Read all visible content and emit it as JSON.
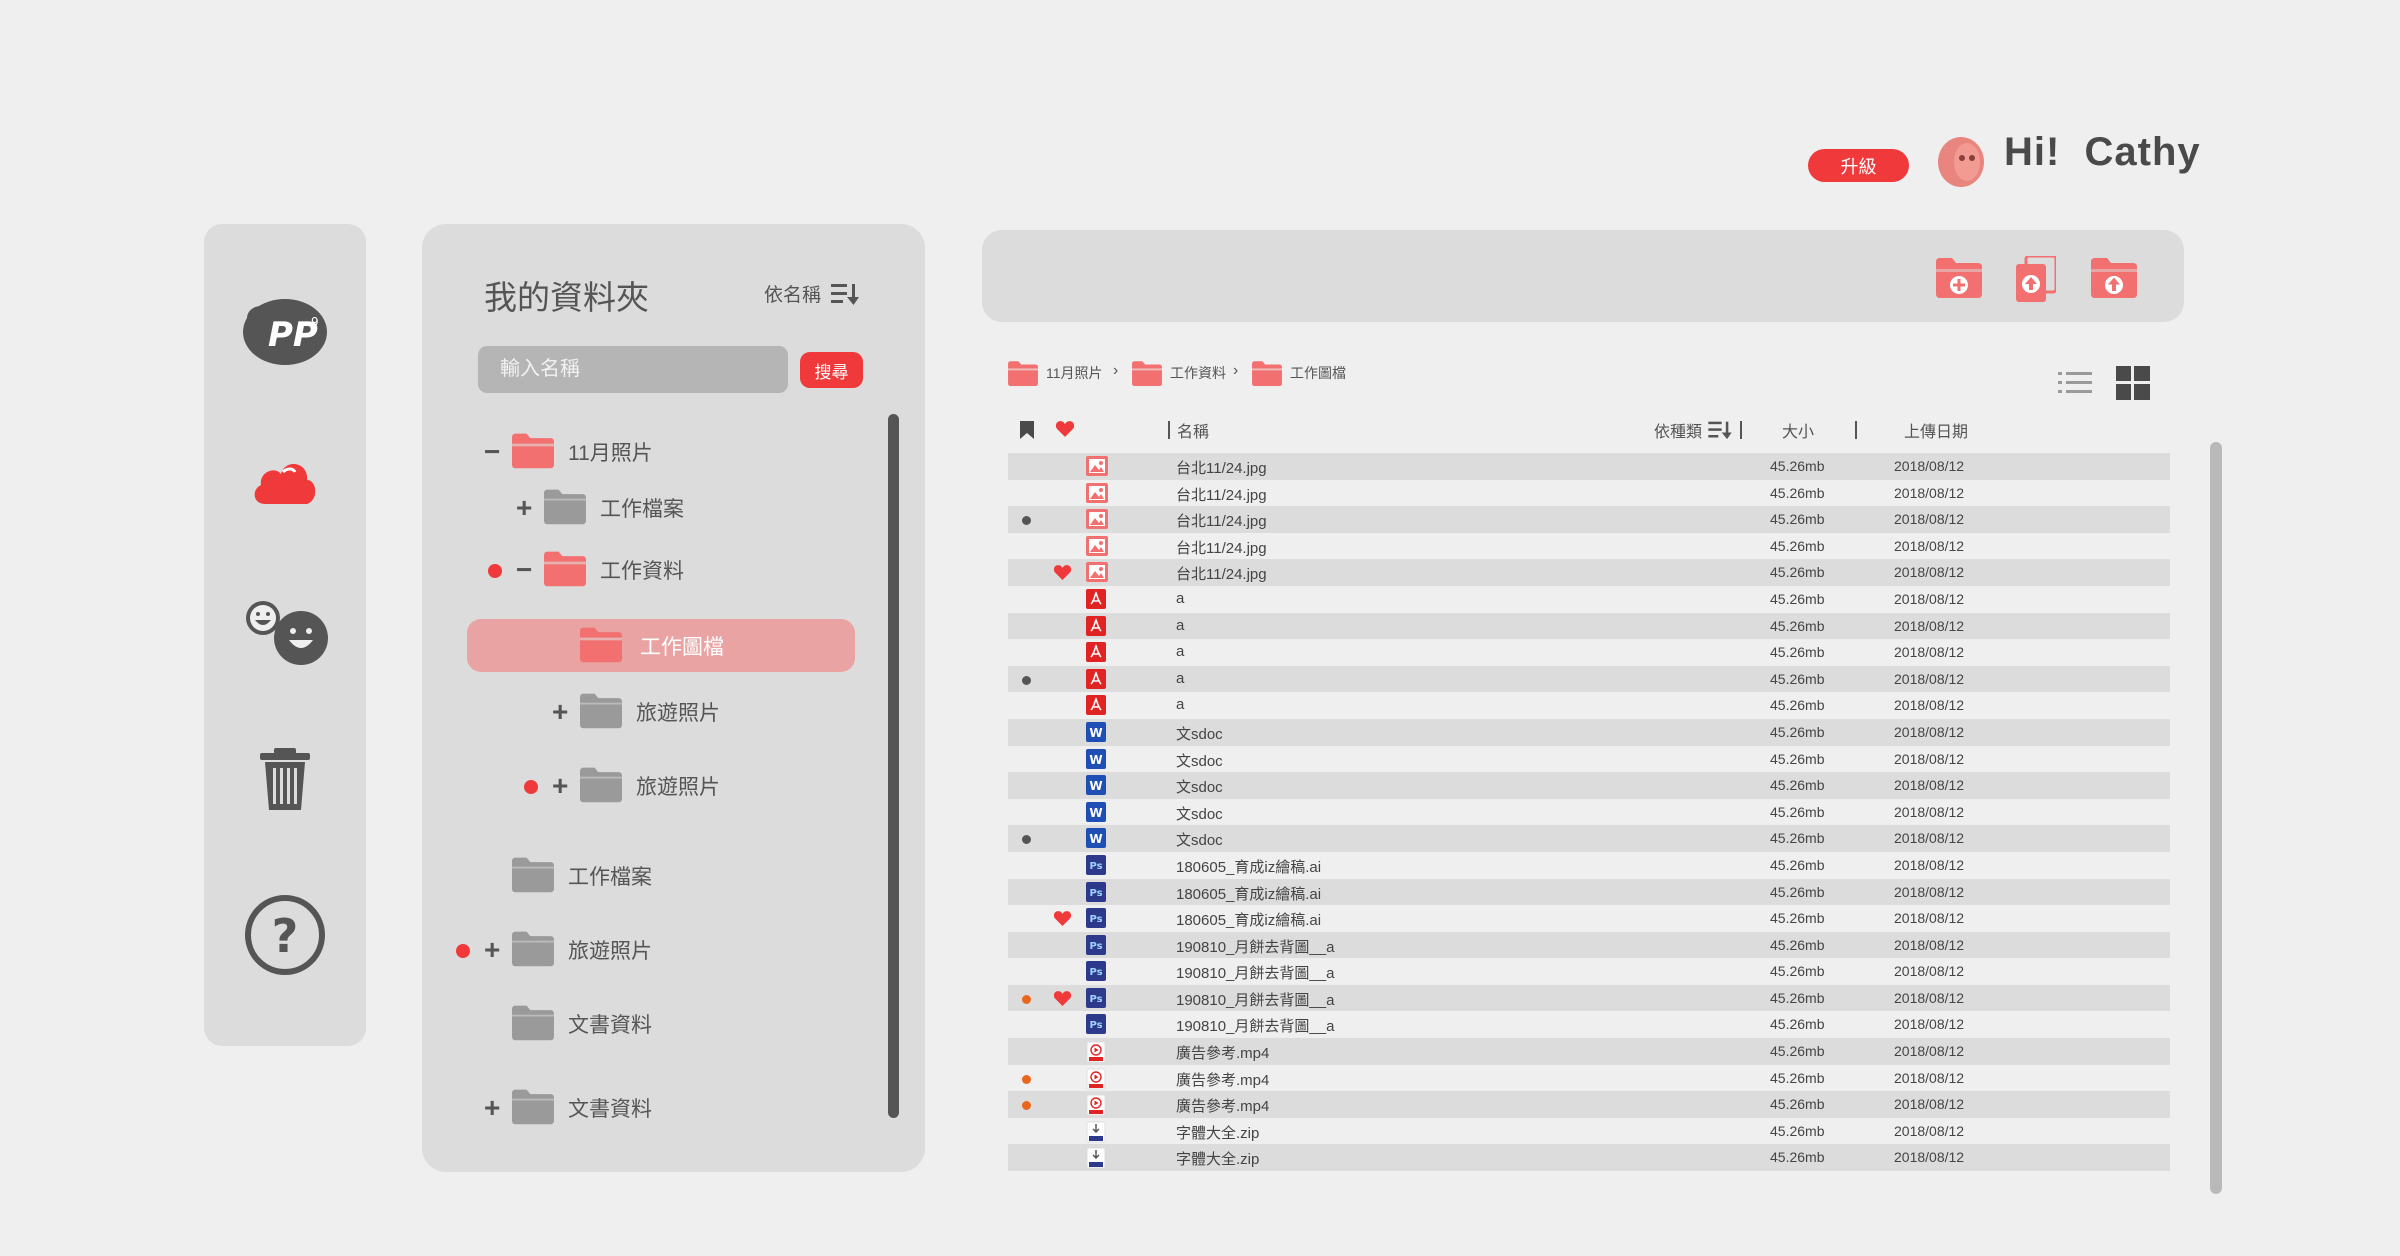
{
  "header": {
    "upgrade_label": "升級",
    "greeting": "Hi!  Cathy"
  },
  "rail": {
    "items": [
      "logo",
      "cloud",
      "friends",
      "trash",
      "help"
    ]
  },
  "folders": {
    "title": "我的資料夾",
    "sort_label": "依名稱",
    "search_placeholder": "輸入名稱",
    "search_button": "搜尋",
    "tree": [
      {
        "label": "11月照片",
        "level": 0,
        "toggle": "−",
        "dot": false,
        "open": true,
        "active": false
      },
      {
        "label": "工作檔案",
        "level": 1,
        "toggle": "+",
        "dot": false,
        "open": false,
        "active": false
      },
      {
        "label": "工作資料",
        "level": 1,
        "toggle": "−",
        "dot": true,
        "open": true,
        "active": false
      },
      {
        "label": "工作圖檔",
        "level": 2,
        "toggle": "",
        "dot": false,
        "open": true,
        "active": true
      },
      {
        "label": "旅遊照片",
        "level": 2,
        "toggle": "+",
        "dot": false,
        "open": false,
        "active": false
      },
      {
        "label": "旅遊照片",
        "level": 2,
        "toggle": "+",
        "dot": true,
        "open": false,
        "active": false
      },
      {
        "label": "工作檔案",
        "level": 0,
        "toggle": "",
        "dot": false,
        "open": false,
        "active": false
      },
      {
        "label": "旅遊照片",
        "level": 0,
        "toggle": "+",
        "dot": true,
        "open": false,
        "active": false
      },
      {
        "label": "文書資料",
        "level": 0,
        "toggle": "",
        "dot": false,
        "open": false,
        "active": false
      },
      {
        "label": "文書資料",
        "level": 0,
        "toggle": "+",
        "dot": false,
        "open": false,
        "active": false
      }
    ]
  },
  "breadcrumb": [
    "11月照片",
    "工作資料",
    "工作圖檔"
  ],
  "table": {
    "col_name": "名稱",
    "col_type_sort": "依種類",
    "col_size": "大小",
    "col_date": "上傳日期",
    "rows": [
      {
        "mark": "",
        "fav": false,
        "type": "image",
        "name": "台北11/24.jpg",
        "size": "45.26mb",
        "date": "2018/08/12"
      },
      {
        "mark": "",
        "fav": false,
        "type": "image",
        "name": "台北11/24.jpg",
        "size": "45.26mb",
        "date": "2018/08/12"
      },
      {
        "mark": "gray",
        "fav": false,
        "type": "image",
        "name": "台北11/24.jpg",
        "size": "45.26mb",
        "date": "2018/08/12"
      },
      {
        "mark": "",
        "fav": false,
        "type": "image",
        "name": "台北11/24.jpg",
        "size": "45.26mb",
        "date": "2018/08/12"
      },
      {
        "mark": "",
        "fav": true,
        "type": "image",
        "name": "台北11/24.jpg",
        "size": "45.26mb",
        "date": "2018/08/12"
      },
      {
        "mark": "",
        "fav": false,
        "type": "pdf",
        "name": "a",
        "size": "45.26mb",
        "date": "2018/08/12"
      },
      {
        "mark": "",
        "fav": false,
        "type": "pdf",
        "name": "a",
        "size": "45.26mb",
        "date": "2018/08/12"
      },
      {
        "mark": "",
        "fav": false,
        "type": "pdf",
        "name": "a",
        "size": "45.26mb",
        "date": "2018/08/12"
      },
      {
        "mark": "gray",
        "fav": false,
        "type": "pdf",
        "name": "a",
        "size": "45.26mb",
        "date": "2018/08/12"
      },
      {
        "mark": "",
        "fav": false,
        "type": "pdf",
        "name": "a",
        "size": "45.26mb",
        "date": "2018/08/12"
      },
      {
        "mark": "",
        "fav": false,
        "type": "word",
        "name": "文sdoc",
        "size": "45.26mb",
        "date": "2018/08/12"
      },
      {
        "mark": "",
        "fav": false,
        "type": "word",
        "name": "文sdoc",
        "size": "45.26mb",
        "date": "2018/08/12"
      },
      {
        "mark": "",
        "fav": false,
        "type": "word",
        "name": "文sdoc",
        "size": "45.26mb",
        "date": "2018/08/12"
      },
      {
        "mark": "",
        "fav": false,
        "type": "word",
        "name": "文sdoc",
        "size": "45.26mb",
        "date": "2018/08/12"
      },
      {
        "mark": "gray",
        "fav": false,
        "type": "word",
        "name": "文sdoc",
        "size": "45.26mb",
        "date": "2018/08/12"
      },
      {
        "mark": "",
        "fav": false,
        "type": "ps",
        "name": "180605_育成iz繪稿.ai",
        "size": "45.26mb",
        "date": "2018/08/12"
      },
      {
        "mark": "",
        "fav": false,
        "type": "ps",
        "name": "180605_育成iz繪稿.ai",
        "size": "45.26mb",
        "date": "2018/08/12"
      },
      {
        "mark": "",
        "fav": true,
        "type": "ps",
        "name": "180605_育成iz繪稿.ai",
        "size": "45.26mb",
        "date": "2018/08/12"
      },
      {
        "mark": "",
        "fav": false,
        "type": "ps",
        "name": "190810_月餅去背圖__a",
        "size": "45.26mb",
        "date": "2018/08/12"
      },
      {
        "mark": "",
        "fav": false,
        "type": "ps",
        "name": "190810_月餅去背圖__a",
        "size": "45.26mb",
        "date": "2018/08/12"
      },
      {
        "mark": "orange",
        "fav": true,
        "type": "ps",
        "name": "190810_月餅去背圖__a",
        "size": "45.26mb",
        "date": "2018/08/12"
      },
      {
        "mark": "",
        "fav": false,
        "type": "ps",
        "name": "190810_月餅去背圖__a",
        "size": "45.26mb",
        "date": "2018/08/12"
      },
      {
        "mark": "",
        "fav": false,
        "type": "video",
        "name": "廣告參考.mp4",
        "size": "45.26mb",
        "date": "2018/08/12"
      },
      {
        "mark": "orange",
        "fav": false,
        "type": "video",
        "name": "廣告參考.mp4",
        "size": "45.26mb",
        "date": "2018/08/12"
      },
      {
        "mark": "orange",
        "fav": false,
        "type": "video",
        "name": "廣告參考.mp4",
        "size": "45.26mb",
        "date": "2018/08/12"
      },
      {
        "mark": "",
        "fav": false,
        "type": "zip",
        "name": "字體大全.zip",
        "size": "45.26mb",
        "date": "2018/08/12"
      },
      {
        "mark": "",
        "fav": false,
        "type": "zip",
        "name": "字體大全.zip",
        "size": "45.26mb",
        "date": "2018/08/12"
      }
    ]
  },
  "colors": {
    "accent": "#f0393a",
    "folder_open": "#f27070",
    "folder_closed": "#9a9a9a",
    "mark_gray": "#555555",
    "mark_orange": "#e8671c",
    "word": "#1f4fb5",
    "ps": "#2d3a8c",
    "pdf": "#e02424"
  }
}
